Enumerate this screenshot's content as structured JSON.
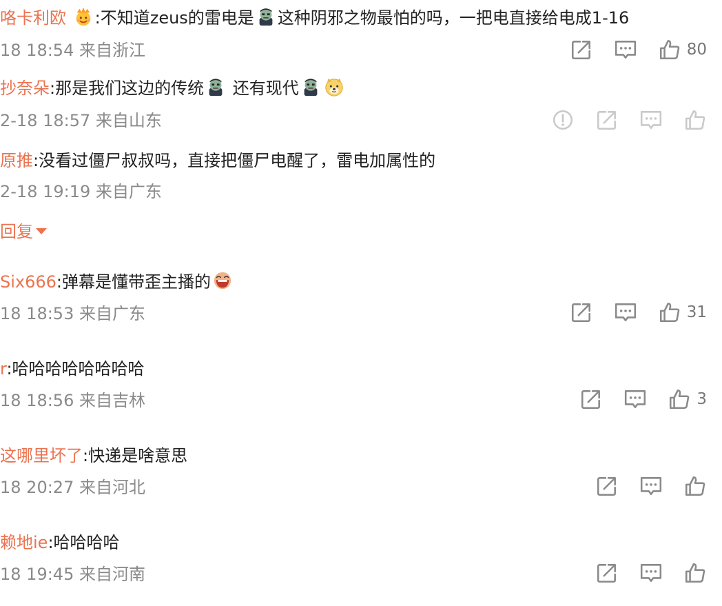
{
  "comments": [
    {
      "user": "咯卡利欧",
      "segments": [
        "",
        ":不知道zeus的雷电是",
        "这种阴邪之物最怕的吗，一把电直接给电成1-16"
      ],
      "time": "18 18:54",
      "location": "来自浙江",
      "likes": "80"
    },
    {
      "user": "抄奈朵",
      "segments": [
        ":那是我们这边的传统",
        " 还有现代",
        ""
      ],
      "time": "2-18 18:57",
      "location": "来自山东",
      "likes": ""
    },
    {
      "user": "原推",
      "segments": [
        ":没看过僵尸叔叔吗，直接把僵尸电醒了，雷电加属性的"
      ],
      "time": "2-18 19:19",
      "location": "来自广东",
      "likes": ""
    },
    {
      "user": "Six666",
      "segments": [
        ":弹幕是懂带歪主播的"
      ],
      "time": "18 18:53",
      "location": "来自广东",
      "likes": "31"
    },
    {
      "user": "r",
      "segments": [
        ":哈哈哈哈哈哈哈哈"
      ],
      "time": "18 18:56",
      "location": "来自吉林",
      "likes": "3"
    },
    {
      "user": "这哪里坏了",
      "segments": [
        ":快递是啥意思"
      ],
      "time": "18 20:27",
      "location": "来自河北",
      "likes": ""
    },
    {
      "user": "赖地ie",
      "segments": [
        ":哈哈哈哈"
      ],
      "time": "18 19:45",
      "location": "来自河南",
      "likes": ""
    }
  ],
  "reply_toggle": "回复",
  "icons": {
    "report": "warning-circle-icon",
    "share": "share-icon",
    "comment": "comment-icon",
    "like": "thumbs-up-icon",
    "emoji_zombie": "zombie-emoji-icon",
    "emoji_crown": "crown-emoji-icon",
    "emoji_doge": "doge-emoji-icon",
    "emoji_laugh": "laugh-emoji-icon"
  },
  "colors": {
    "username": "#eb7350",
    "text": "#222222",
    "meta": "#8a8a8a",
    "icon": "#8a8a8a"
  }
}
